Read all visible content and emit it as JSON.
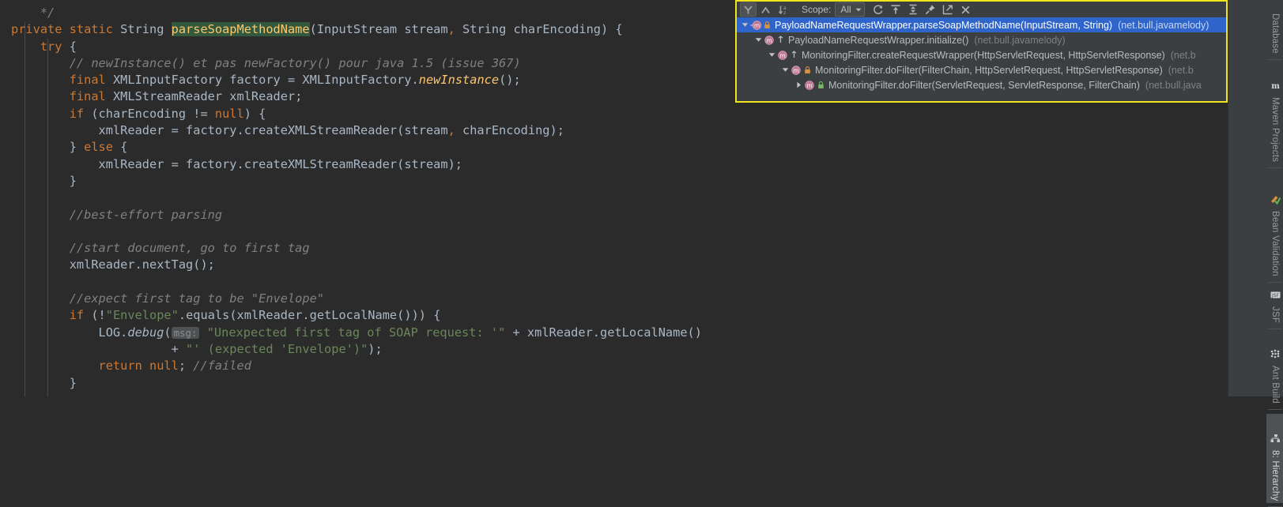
{
  "app": {
    "theme": "darcula",
    "accent_selection": "#2f65ca",
    "highlight_border": "#f2e41c"
  },
  "editor": {
    "name": "java-source-editor",
    "language": "java",
    "highlighted_symbol": "parseSoapMethodName",
    "lines": [
      {
        "id": "l1",
        "indent": 1,
        "tokens": [
          {
            "t": "cmt",
            "v": "*/"
          }
        ]
      },
      {
        "id": "l2",
        "indent": 0,
        "tokens": [
          {
            "t": "kw",
            "v": "private "
          },
          {
            "t": "kw",
            "v": "static "
          },
          {
            "t": "plain",
            "v": "String "
          },
          {
            "t": "hl",
            "v": "parseSoapMethodName"
          },
          {
            "t": "plain",
            "v": "(InputStream stream"
          },
          {
            "t": "kw",
            "v": ","
          },
          {
            "t": "plain",
            "v": " String charEncoding) {"
          }
        ]
      },
      {
        "id": "l3",
        "indent": 1,
        "tokens": [
          {
            "t": "kw",
            "v": "try"
          },
          {
            "t": "plain",
            "v": " {"
          }
        ]
      },
      {
        "id": "l4",
        "indent": 2,
        "tokens": [
          {
            "t": "cmt",
            "v": "// newInstance() et pas newFactory() pour java 1.5 (issue 367)"
          }
        ]
      },
      {
        "id": "l5",
        "indent": 2,
        "tokens": [
          {
            "t": "kw",
            "v": "final "
          },
          {
            "t": "plain",
            "v": "XMLInputFactory factory = XMLInputFactory."
          },
          {
            "t": "mth-i",
            "v": "newInstance"
          },
          {
            "t": "plain",
            "v": "();"
          }
        ]
      },
      {
        "id": "l6",
        "indent": 2,
        "tokens": [
          {
            "t": "kw",
            "v": "final "
          },
          {
            "t": "plain",
            "v": "XMLStreamReader xmlReader;"
          }
        ]
      },
      {
        "id": "l7",
        "indent": 2,
        "tokens": [
          {
            "t": "kw",
            "v": "if"
          },
          {
            "t": "plain",
            "v": " (charEncoding != "
          },
          {
            "t": "kw",
            "v": "null"
          },
          {
            "t": "plain",
            "v": ") {"
          }
        ]
      },
      {
        "id": "l8",
        "indent": 3,
        "tokens": [
          {
            "t": "plain",
            "v": "xmlReader = factory.createXMLStreamReader(stream"
          },
          {
            "t": "kw",
            "v": ","
          },
          {
            "t": "plain",
            "v": " charEncoding);"
          }
        ]
      },
      {
        "id": "l9",
        "indent": 2,
        "tokens": [
          {
            "t": "plain",
            "v": "} "
          },
          {
            "t": "kw",
            "v": "else"
          },
          {
            "t": "plain",
            "v": " {"
          }
        ]
      },
      {
        "id": "l10",
        "indent": 3,
        "tokens": [
          {
            "t": "plain",
            "v": "xmlReader = factory.createXMLStreamReader(stream);"
          }
        ]
      },
      {
        "id": "l11",
        "indent": 2,
        "tokens": [
          {
            "t": "plain",
            "v": "}"
          }
        ]
      },
      {
        "id": "l12",
        "indent": 0,
        "tokens": []
      },
      {
        "id": "l13",
        "indent": 2,
        "tokens": [
          {
            "t": "cmt",
            "v": "//best-effort parsing"
          }
        ]
      },
      {
        "id": "l14",
        "indent": 0,
        "tokens": []
      },
      {
        "id": "l15",
        "indent": 2,
        "tokens": [
          {
            "t": "cmt",
            "v": "//start document, go to first tag"
          }
        ]
      },
      {
        "id": "l16",
        "indent": 2,
        "tokens": [
          {
            "t": "plain",
            "v": "xmlReader.nextTag();"
          }
        ]
      },
      {
        "id": "l17",
        "indent": 0,
        "tokens": []
      },
      {
        "id": "l18",
        "indent": 2,
        "tokens": [
          {
            "t": "cmt",
            "v": "//expect first tag to be \"Envelope\""
          }
        ]
      },
      {
        "id": "l19",
        "indent": 2,
        "tokens": [
          {
            "t": "kw",
            "v": "if"
          },
          {
            "t": "plain",
            "v": " (!"
          },
          {
            "t": "str",
            "v": "\"Envelope\""
          },
          {
            "t": "plain",
            "v": ".equals(xmlReader.getLocalName())) {"
          }
        ]
      },
      {
        "id": "l20",
        "indent": 3,
        "tokens": [
          {
            "t": "plain",
            "v": "LOG."
          },
          {
            "t": "stat",
            "v": "debug"
          },
          {
            "t": "plain",
            "v": "("
          },
          {
            "t": "hint",
            "v": "msg:"
          },
          {
            "t": "str",
            "v": "\"Unexpected first tag of SOAP request: '\""
          },
          {
            "t": "plain",
            "v": " + xmlReader.getLocalName()"
          }
        ]
      },
      {
        "id": "l21",
        "indent": 5,
        "tokens": [
          {
            "t": "plain",
            "v": "  + "
          },
          {
            "t": "str",
            "v": "\"' (expected 'Envelope')\""
          },
          {
            "t": "plain",
            "v": ");"
          }
        ]
      },
      {
        "id": "l22",
        "indent": 3,
        "tokens": [
          {
            "t": "kw",
            "v": "return null"
          },
          {
            "t": "plain",
            "v": "; "
          },
          {
            "t": "cmt",
            "v": "//failed"
          }
        ]
      },
      {
        "id": "l23",
        "indent": 2,
        "tokens": [
          {
            "t": "plain",
            "v": "}"
          }
        ]
      }
    ]
  },
  "hierarchy_panel": {
    "name": "call-hierarchy-tool-window",
    "toolbar": {
      "buttons": [
        {
          "id": "callee",
          "icon": "callee-hierarchy-icon",
          "label": "Callee Hierarchy",
          "selected": true
        },
        {
          "id": "caller",
          "icon": "caller-hierarchy-icon",
          "label": "Caller Hierarchy",
          "selected": false
        },
        {
          "id": "sort",
          "icon": "sort-alphabetically-icon",
          "label": "Sort Alphabetically",
          "selected": false
        }
      ],
      "scope_label": "Scope:",
      "scope_value": "All",
      "scope_options": [
        "All"
      ],
      "actions": [
        {
          "id": "refresh",
          "icon": "refresh-icon",
          "label": "Refresh"
        },
        {
          "id": "export-textfile",
          "icon": "export-to-textfile-icon",
          "label": "Export to Text File"
        },
        {
          "id": "expand-collapse",
          "icon": "expand-collapse-icon",
          "label": "Expand All / Collapse All"
        },
        {
          "id": "pin",
          "icon": "pin-tab-icon",
          "label": "Pin Tab"
        },
        {
          "id": "open-source",
          "icon": "open-in-new-window-icon",
          "label": "Open in New Window"
        },
        {
          "id": "close",
          "icon": "close-icon",
          "label": "Close"
        }
      ]
    },
    "tree": [
      {
        "indent": 0,
        "expander": "expanded",
        "method_icon": "method-icon-navigate",
        "visibility_icon": "visibility-private-icon",
        "name": "PayloadNameRequestWrapper.parseSoapMethodName(InputStream, String)",
        "package": "(net.bull.javamelody)",
        "selected": true
      },
      {
        "indent": 1,
        "expander": "expanded",
        "method_icon": "method-icon",
        "visibility_icon": "visibility-package-local-icon",
        "name": "PayloadNameRequestWrapper.initialize()",
        "package": "(net.bull.javamelody)",
        "selected": false
      },
      {
        "indent": 2,
        "expander": "expanded",
        "method_icon": "method-icon",
        "visibility_icon": "visibility-package-local-icon",
        "name": "MonitoringFilter.createRequestWrapper(HttpServletRequest, HttpServletResponse)",
        "package": "(net.b",
        "selected": false
      },
      {
        "indent": 3,
        "expander": "expanded",
        "method_icon": "method-icon",
        "visibility_icon": "visibility-private-icon",
        "name": "MonitoringFilter.doFilter(FilterChain, HttpServletRequest, HttpServletResponse)",
        "package": "(net.b",
        "selected": false
      },
      {
        "indent": 4,
        "expander": "collapsed",
        "method_icon": "method-icon",
        "visibility_icon": "visibility-public-icon",
        "name": "MonitoringFilter.doFilter(ServletRequest, ServletResponse, FilterChain)",
        "package": "(net.bull.java",
        "selected": false
      }
    ]
  },
  "tool_strip": {
    "name": "right-tool-window-strip",
    "tabs": [
      {
        "id": "database",
        "label": "Database",
        "icon": "database-icon",
        "active": false,
        "has_icon": false
      },
      {
        "id": "maven",
        "label": "Maven Projects",
        "icon": "maven-icon",
        "active": false,
        "has_icon": true
      },
      {
        "id": "bean-validation",
        "label": "Bean Validation",
        "icon": "bean-validation-icon",
        "active": false,
        "has_icon": true
      },
      {
        "id": "jsf",
        "label": "JSF",
        "icon": "jsf-icon",
        "active": false,
        "has_icon": true
      },
      {
        "id": "ant-build",
        "label": "Ant Build",
        "icon": "ant-build-icon",
        "active": false,
        "has_icon": true
      },
      {
        "id": "hierarchy",
        "label": "8: Hierarchy",
        "icon": "hierarchy-icon",
        "active": true,
        "has_icon": true
      }
    ]
  }
}
